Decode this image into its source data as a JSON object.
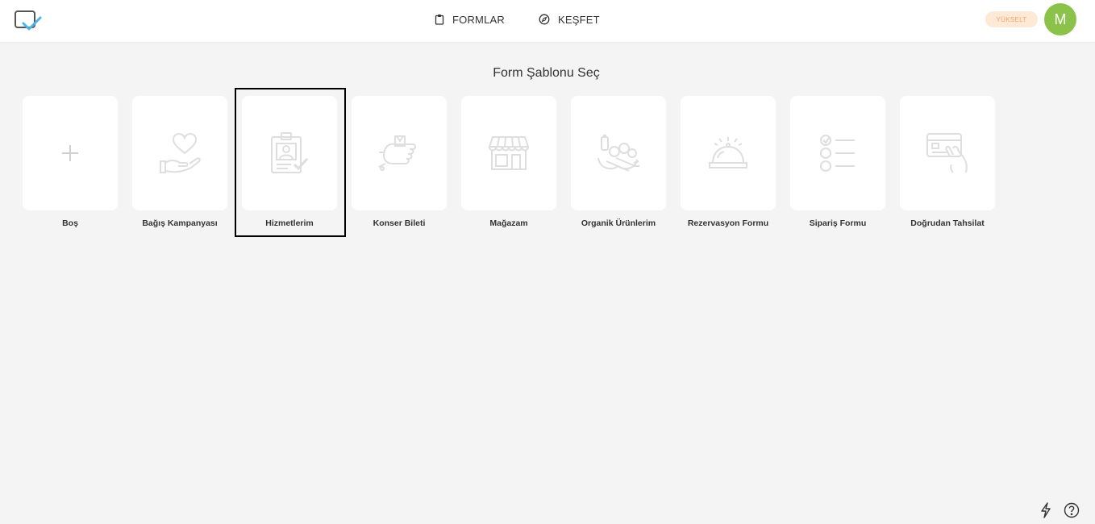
{
  "nav": {
    "forms_label": "FORMLAR",
    "explore_label": "KEŞFET"
  },
  "header": {
    "upgrade_label": "YÜKSELT",
    "avatar_initial": "M"
  },
  "page": {
    "title": "Form Şablonu Seç"
  },
  "templates": [
    {
      "label": "Boş",
      "icon": "plus-icon"
    },
    {
      "label": "Bağış Kampanyası",
      "icon": "heart-hand-icon"
    },
    {
      "label": "Hizmetlerim",
      "icon": "id-card-icon",
      "selected": true
    },
    {
      "label": "Konser Bileti",
      "icon": "ticket-hand-icon"
    },
    {
      "label": "Mağazam",
      "icon": "storefront-icon"
    },
    {
      "label": "Organik Ürünlerim",
      "icon": "vegetables-icon"
    },
    {
      "label": "Rezervasyon Formu",
      "icon": "service-bell-icon"
    },
    {
      "label": "Sipariş Formu",
      "icon": "checklist-icon"
    },
    {
      "label": "Doğrudan Tahsilat",
      "icon": "credit-card-hand-icon"
    }
  ],
  "colors": {
    "accent_green": "#8bc34a",
    "upgrade_bg": "#fde9d6",
    "upgrade_text": "#f3a66b",
    "logo_blue": "#4db6e6"
  }
}
